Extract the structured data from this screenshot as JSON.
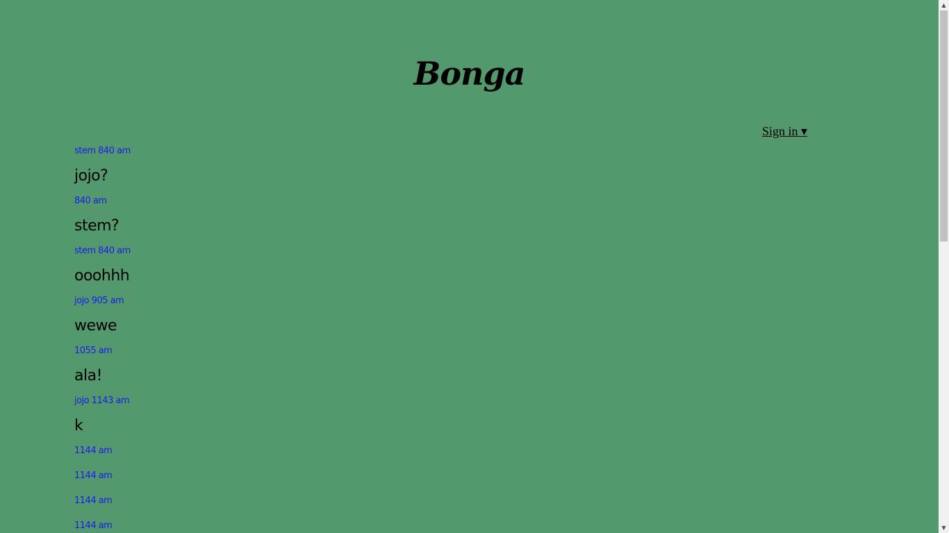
{
  "header": {
    "title": "Bonga",
    "signin_label": "Sign in ▾"
  },
  "messages": [
    {
      "meta": "stem 840 am",
      "text": "jojo?"
    },
    {
      "meta": "840 am",
      "text": "stem?"
    },
    {
      "meta": "stem 840 am",
      "text": "ooohhh"
    },
    {
      "meta": "jojo 905 am",
      "text": "wewe"
    },
    {
      "meta": "1055 am",
      "text": "ala!"
    },
    {
      "meta": "jojo 1143 am",
      "text": "k"
    },
    {
      "meta": "1144 am",
      "text": ""
    },
    {
      "meta": "1144 am",
      "text": ""
    },
    {
      "meta": "1144 am",
      "text": ""
    },
    {
      "meta": "1144 am",
      "text": ""
    }
  ],
  "colors": {
    "background": "#54996d",
    "link": "#1a1af0",
    "text": "#000000"
  },
  "scrollbar": {
    "up_icon": "triangle-up",
    "down_icon": "triangle-down"
  }
}
